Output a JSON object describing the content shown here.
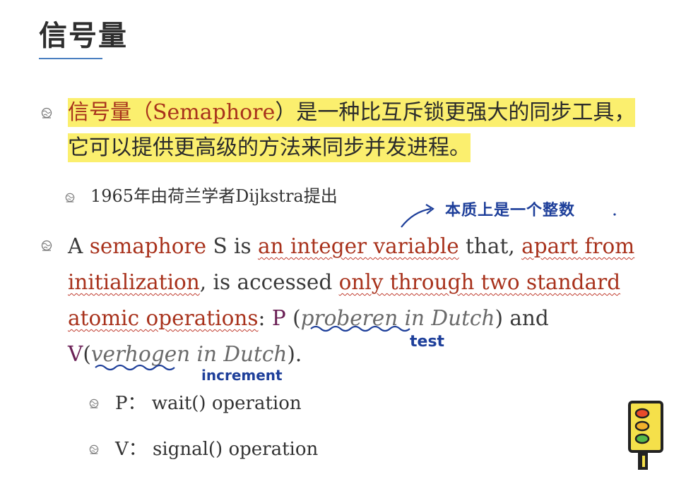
{
  "slide": {
    "title": "信号量"
  },
  "bullet1": {
    "highlighted_prefix": "信号量（",
    "term": "Semaphore",
    "rest": "）是一种比互斥锁更强大的同步工具，它可以提供更高级的方法来同步并发进程。"
  },
  "bullet1_sub": {
    "text": "1965年由荷兰学者Dijkstra提出"
  },
  "bullet2": {
    "a": "A ",
    "semaphore": "semaphore",
    "s_is": " S is ",
    "integer_var": "an integer variable",
    "that": " that, ",
    "apart_from": "apart from",
    "space": " ",
    "initialization": "initialization",
    "accessed": ", is accessed ",
    "only_through": "only through two standard",
    "space2": " ",
    "atomic": "atomic operations",
    "colon_p": ":  ",
    "p_letter": "P",
    "paren_open": " (",
    "proberen": "proberen in Dutch",
    "and": ") and",
    "v_letter": "V",
    "paren_open2": "(",
    "verhogen": "verhogen in Dutch",
    "close": ")."
  },
  "sub_p": {
    "text": "P： wait() operation"
  },
  "sub_v": {
    "text": "V： signal() operation"
  },
  "annotations": {
    "essence": "本质上是一个整数",
    "test": "test",
    "increment": "increment"
  },
  "colors": {
    "highlight": "#fbef6e",
    "accent_red": "#a8321c",
    "ink_blue": "#1e3f9a",
    "title_rule": "#4a7fc0"
  }
}
